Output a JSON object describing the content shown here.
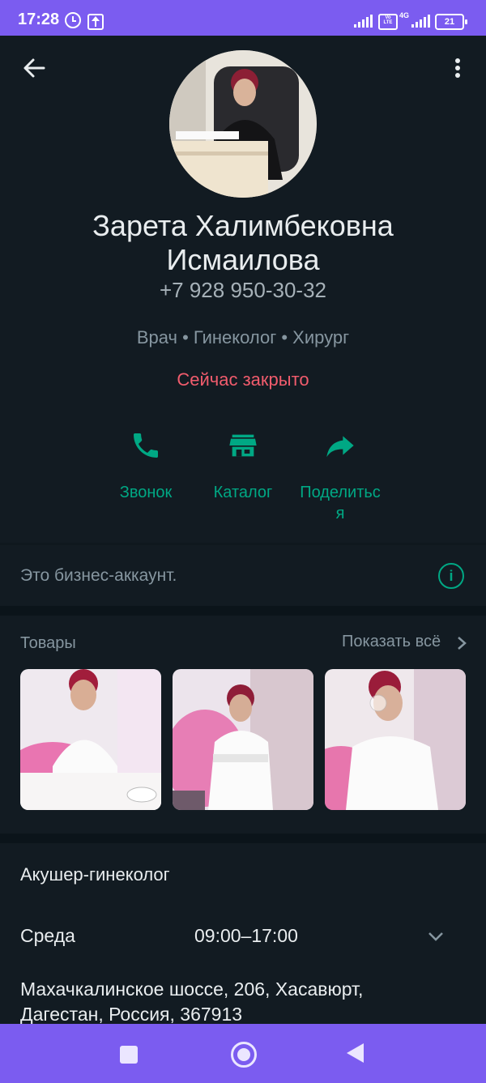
{
  "status_bar": {
    "time": "17:28",
    "network": "4G",
    "volte": "Vo LTE",
    "battery": "21"
  },
  "profile": {
    "name_line1": "Зарета Халимбековна",
    "name_line2": "Исмаилова",
    "phone": "+7 928 950-30-32",
    "categories": "Врач • Гинеколог • Хирург",
    "open_status": "Сейчас закрыто"
  },
  "actions": [
    {
      "label": "Звонок",
      "icon": "phone-icon"
    },
    {
      "label": "Каталог",
      "icon": "store-icon"
    },
    {
      "label_line1": "Поделитьс",
      "label_line2": "я",
      "icon": "share-icon"
    }
  ],
  "business_notice": "Это бизнес-аккаунт.",
  "products": {
    "title": "Товары",
    "show_all": "Показать всё"
  },
  "details": {
    "title": "Акушер-гинеколог",
    "day": "Среда",
    "hours": "09:00–17:00",
    "address_line1": "Махачкалинское шоссе, 206, Хасавюрт,",
    "address_line2": "Дагестан, Россия, 367913"
  },
  "colors": {
    "accent": "#00a884",
    "closed": "#f15c6d",
    "background": "#121b22",
    "system_bar": "#7b5cf0"
  }
}
